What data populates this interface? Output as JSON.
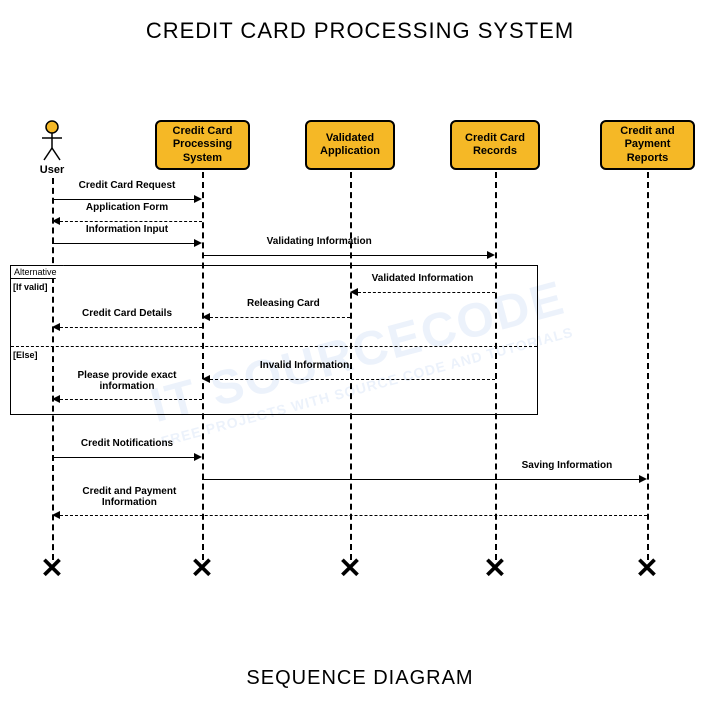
{
  "title": "CREDIT CARD PROCESSING SYSTEM",
  "subtitle": "SEQUENCE DIAGRAM",
  "watermark": {
    "main": "IT SOURCECODE",
    "sub": "FREE PROJECTS WITH SOURCE CODE AND TUTORIALS"
  },
  "actors": {
    "user": "User",
    "system": "Credit Card Processing System",
    "validated": "Validated Application",
    "records": "Credit Card Records",
    "reports": "Credit and Payment Reports"
  },
  "alt": {
    "label": "Alternative",
    "guard_if": "[If valid]",
    "guard_else": "[Else]"
  },
  "messages": {
    "m1": "Credit Card Request",
    "m2": "Application Form",
    "m3": "Information Input",
    "m4": "Validating Information",
    "m5": "Validated Information",
    "m6": "Releasing Card",
    "m7": "Credit Card Details",
    "m8": "Invalid Information",
    "m9": "Please provide exact information",
    "m10": "Credit Notifications",
    "m11": "Saving Information",
    "m12": "Credit and Payment Information"
  },
  "chart_data": {
    "type": "sequence_diagram",
    "participants": [
      {
        "id": "user",
        "name": "User",
        "kind": "actor"
      },
      {
        "id": "system",
        "name": "Credit Card Processing System",
        "kind": "object"
      },
      {
        "id": "validated",
        "name": "Validated Application",
        "kind": "object"
      },
      {
        "id": "records",
        "name": "Credit Card Records",
        "kind": "object"
      },
      {
        "id": "reports",
        "name": "Credit and Payment Reports",
        "kind": "object"
      }
    ],
    "messages": [
      {
        "from": "user",
        "to": "system",
        "label": "Credit Card Request",
        "style": "sync"
      },
      {
        "from": "system",
        "to": "user",
        "label": "Application Form",
        "style": "return"
      },
      {
        "from": "user",
        "to": "system",
        "label": "Information Input",
        "style": "sync"
      },
      {
        "from": "system",
        "to": "records",
        "label": "Validating Information",
        "style": "sync"
      },
      {
        "fragment": "alt",
        "label": "Alternative",
        "sections": [
          {
            "guard": "[If valid]",
            "messages": [
              {
                "from": "records",
                "to": "validated",
                "label": "Validated Information",
                "style": "return"
              },
              {
                "from": "validated",
                "to": "system",
                "label": "Releasing Card",
                "style": "return"
              },
              {
                "from": "system",
                "to": "user",
                "label": "Credit Card Details",
                "style": "return"
              }
            ]
          },
          {
            "guard": "[Else]",
            "messages": [
              {
                "from": "records",
                "to": "system",
                "label": "Invalid Information",
                "style": "return"
              },
              {
                "from": "system",
                "to": "user",
                "label": "Please provide exact information",
                "style": "return"
              }
            ]
          }
        ]
      },
      {
        "from": "user",
        "to": "system",
        "label": "Credit Notifications",
        "style": "sync"
      },
      {
        "from": "system",
        "to": "reports",
        "label": "Saving Information",
        "style": "sync"
      },
      {
        "from": "reports",
        "to": "user",
        "label": "Credit and Payment Information",
        "style": "return"
      }
    ]
  }
}
